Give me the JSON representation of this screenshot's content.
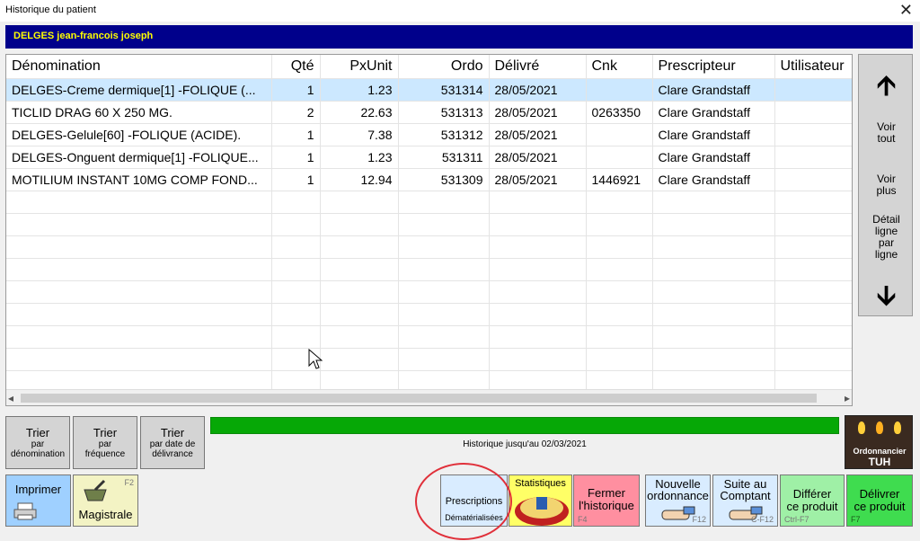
{
  "window": {
    "title": "Historique du patient",
    "close_glyph": "✕"
  },
  "patient": {
    "name": "DELGES jean-francois joseph"
  },
  "table": {
    "columns": [
      "Dénomination",
      "Qté",
      "PxUnit",
      "Ordo",
      "Délivré",
      "Cnk",
      "Prescripteur",
      "Utilisateur"
    ],
    "rows": [
      {
        "denomination": "DELGES-Creme dermique[1] -FOLIQUE (...",
        "qte": "1",
        "pxunit": "1.23",
        "ordo": "531314",
        "delivre": "28/05/2021",
        "cnk": "",
        "prescripteur": "Clare Grandstaff",
        "utilisateur": ""
      },
      {
        "denomination": "TICLID DRAG 60 X 250 MG.",
        "qte": "2",
        "pxunit": "22.63",
        "ordo": "531313",
        "delivre": "28/05/2021",
        "cnk": "0263350",
        "prescripteur": "Clare Grandstaff",
        "utilisateur": ""
      },
      {
        "denomination": "DELGES-Gelule[60] -FOLIQUE (ACIDE).",
        "qte": "1",
        "pxunit": "7.38",
        "ordo": "531312",
        "delivre": "28/05/2021",
        "cnk": "",
        "prescripteur": "Clare Grandstaff",
        "utilisateur": ""
      },
      {
        "denomination": "DELGES-Onguent dermique[1] -FOLIQUE...",
        "qte": "1",
        "pxunit": "1.23",
        "ordo": "531311",
        "delivre": "28/05/2021",
        "cnk": "",
        "prescripteur": "Clare Grandstaff",
        "utilisateur": ""
      },
      {
        "denomination": "MOTILIUM INSTANT 10MG COMP FOND...",
        "qte": "1",
        "pxunit": "12.94",
        "ordo": "531309",
        "delivre": "28/05/2021",
        "cnk": "1446921",
        "prescripteur": "Clare Grandstaff",
        "utilisateur": ""
      }
    ],
    "selected_row": 0
  },
  "side_panel": {
    "up_icon": "arrow-up-icon",
    "voir_tout": [
      "Voir",
      "tout"
    ],
    "voir_plus": [
      "Voir",
      "plus"
    ],
    "detail": [
      "Détail",
      "ligne",
      "par",
      "ligne"
    ],
    "down_icon": "arrow-down-icon"
  },
  "sort_buttons": [
    {
      "label": "Trier",
      "sub": [
        "par",
        "dénomination"
      ]
    },
    {
      "label": "Trier",
      "sub": [
        "par",
        "fréquence"
      ]
    },
    {
      "label": "Trier",
      "sub": [
        "par date de",
        "délivrance"
      ]
    }
  ],
  "history": {
    "text": "Historique jusqu'au 02/03/2021",
    "progress": 1.0
  },
  "tuh": {
    "line1": "Ordonnancier",
    "line2": "TUH"
  },
  "buttons": {
    "imprimer": {
      "label": "Imprimer"
    },
    "magistrale": {
      "label": "Magistrale",
      "key": "F2"
    },
    "prescriptions": {
      "label": "Prescriptions",
      "sub": "Dématérialisées"
    },
    "statistiques": {
      "label": "Statistiques"
    },
    "fermer": {
      "label": [
        "Fermer",
        "l'historique"
      ],
      "key": "F4"
    },
    "nouvelle": {
      "label": [
        "Nouvelle",
        "ordonnance"
      ],
      "key": "F12"
    },
    "suite": {
      "label": [
        "Suite au",
        "Comptant"
      ],
      "key": "C-F12"
    },
    "differer": {
      "label": [
        "Différer",
        "ce produit"
      ],
      "key": "Ctrl-F7"
    },
    "delivrer": {
      "label": [
        "Délivrer",
        "ce produit"
      ],
      "key": "F7"
    }
  },
  "colors": {
    "patient_bar": "#00008b",
    "patient_text": "#ffff00",
    "progress": "#06a806",
    "imprimer": "#9fd0ff",
    "magistrale": "#f3f3c4",
    "prescriptions": "#d9ecff",
    "statistiques": "#ffff66",
    "fermer": "#ff8fa0",
    "nouvelle": "#d9ecff",
    "suite": "#d9ecff",
    "differer": "#9ff0a6",
    "delivrer": "#3fdc4f",
    "selected_row": "#cce8ff",
    "highlight_circle": "#e0303a"
  }
}
